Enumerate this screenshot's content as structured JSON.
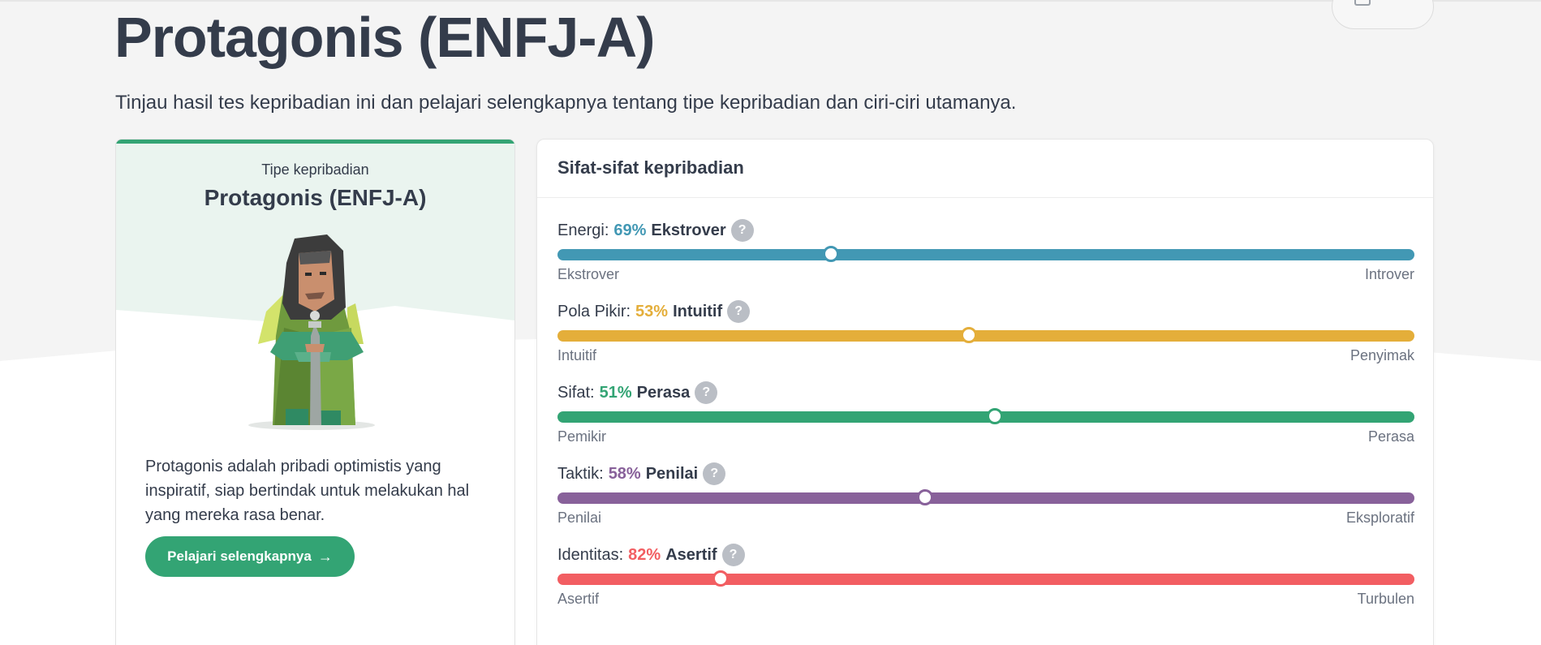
{
  "page": {
    "title": "Protagonis (ENFJ-A)",
    "subtitle": "Tinjau hasil tes kepribadian ini dan pelajari selengkapnya tentang tipe kepribadian dan ciri-ciri utamanya."
  },
  "type_card": {
    "label": "Tipe kepribadian",
    "type_name": "Protagonis (ENFJ-A)",
    "description": "Protagonis adalah pribadi optimistis yang inspiratif, siap bertindak untuk melakukan hal yang mereka rasa benar.",
    "button_label": "Pelajari selengkapnya",
    "button_icon": "arrow-right-icon"
  },
  "traits": {
    "title": "Sifat-sifat kepribadian",
    "help_glyph": "?",
    "items": [
      {
        "name": "Energi:",
        "percent": "69%",
        "trait": "Ekstrover",
        "left_label": "Ekstrover",
        "right_label": "Introver",
        "color": "#4298b4",
        "position_fraction": 0.319
      },
      {
        "name": "Pola Pikir:",
        "percent": "53%",
        "trait": "Intuitif",
        "left_label": "Intuitif",
        "right_label": "Penyimak",
        "color": "#e4ae3a",
        "position_fraction": 0.48
      },
      {
        "name": "Sifat:",
        "percent": "51%",
        "trait": "Perasa",
        "left_label": "Pemikir",
        "right_label": "Perasa",
        "color": "#33a474",
        "position_fraction": 0.51
      },
      {
        "name": "Taktik:",
        "percent": "58%",
        "trait": "Penilai",
        "left_label": "Penilai",
        "right_label": "Eksploratif",
        "color": "#88619a",
        "position_fraction": 0.429
      },
      {
        "name": "Identitas:",
        "percent": "82%",
        "trait": "Asertif",
        "left_label": "Asertif",
        "right_label": "Turbulen",
        "color": "#f25e62",
        "position_fraction": 0.19
      }
    ]
  }
}
